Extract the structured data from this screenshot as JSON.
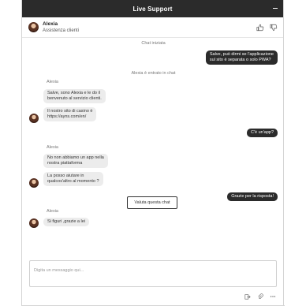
{
  "window": {
    "title": "Live Support"
  },
  "agent": {
    "name": "Alexia",
    "role": "Assistenza clienti"
  },
  "messages": {
    "chat_started": "Chat iniziata",
    "user_1_line1": "Salve, può dirmi se l'applicazione",
    "user_1_line2": "sul sito è separata o solo PWA?",
    "agent_joined": "Alexia è entrato in chat",
    "sender_1": "Alexia",
    "agent_1_line1": "Salve, sono Alexia e le do il",
    "agent_1_line2": "benvenuto al servizio clienti.",
    "agent_2_line1": "Il nostro sito di casino è",
    "agent_2_line2": "https://ayns.com/en/",
    "user_2": "C'è un'app?",
    "sender_2": "Alexia",
    "agent_3_line1": "No non abbiamo un app nella",
    "agent_3_line2": "nostra piattaforma",
    "agent_4_line1": "La posso aiutare in",
    "agent_4_line2": "qualcos'altro al momento ?",
    "user_3": "Grazie per la risposta!",
    "sender_3": "Alexia",
    "agent_5": "Si figuri ,grazie a lei"
  },
  "rate_chat_label": "Valuta questa chat",
  "composer": {
    "placeholder": "Digita un messaggio qui...",
    "value": ""
  },
  "icons": {
    "thumbs_up": "thumbs-up-icon",
    "thumbs_down": "thumbs-down-icon",
    "share": "share-icon",
    "attach": "paperclip-icon",
    "more": "more-icon"
  },
  "colors": {
    "titlebar": "#2b2b2b",
    "user_bubble": "#2b2b2b",
    "agent_bubble": "#ececec"
  }
}
